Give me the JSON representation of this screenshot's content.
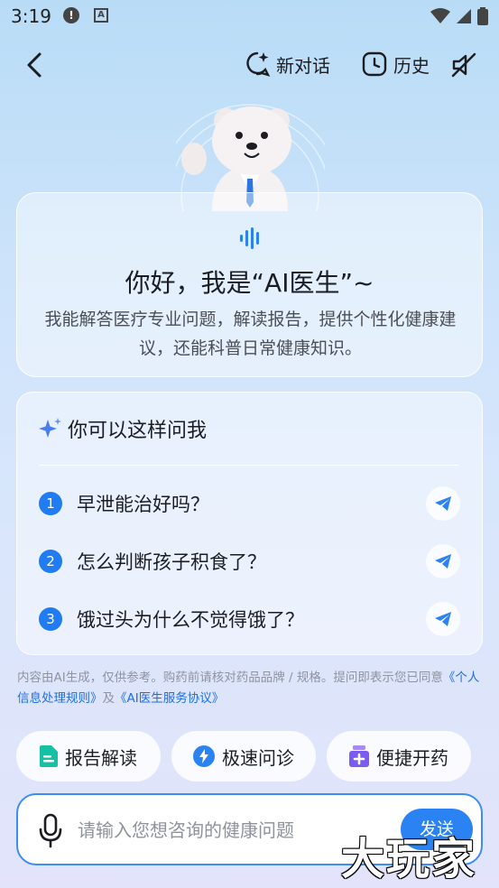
{
  "status_bar": {
    "time": "3:19"
  },
  "nav": {
    "new_chat": "新对话",
    "history": "历史"
  },
  "greeting": {
    "title": "你好，我是“AI医生”~",
    "description": "我能解答医疗专业问题，解读报告，提供个性化健康建议，还能科普日常健康知识。"
  },
  "suggestions": {
    "heading": "你可以这样问我",
    "items": [
      {
        "num": "1",
        "text": "早泄能治好吗？"
      },
      {
        "num": "2",
        "text": "怎么判断孩子积食了？"
      },
      {
        "num": "3",
        "text": "饿过头为什么不觉得饿了？"
      }
    ]
  },
  "disclaimer": {
    "text": "内容由AI生成，仅供参考。购药前请核对药品品牌 / 规格。提问即表示您已同意",
    "link1": "《个人信息处理规则》",
    "and": "及",
    "link2": "《AI医生服务协议》"
  },
  "quick_actions": {
    "report": "报告解读",
    "consult": "极速问诊",
    "medicine": "便捷开药"
  },
  "input": {
    "placeholder": "请输入您想咨询的健康问题",
    "send": "发送"
  },
  "watermark": "大玩家",
  "colors": {
    "accent": "#2b83f3",
    "number_badge": "#1f7cf2",
    "link": "#1f6fe0",
    "report_icon": "#14c2a3",
    "consult_icon": "#2b83f3",
    "medicine_icon": "#7b5cf0"
  }
}
